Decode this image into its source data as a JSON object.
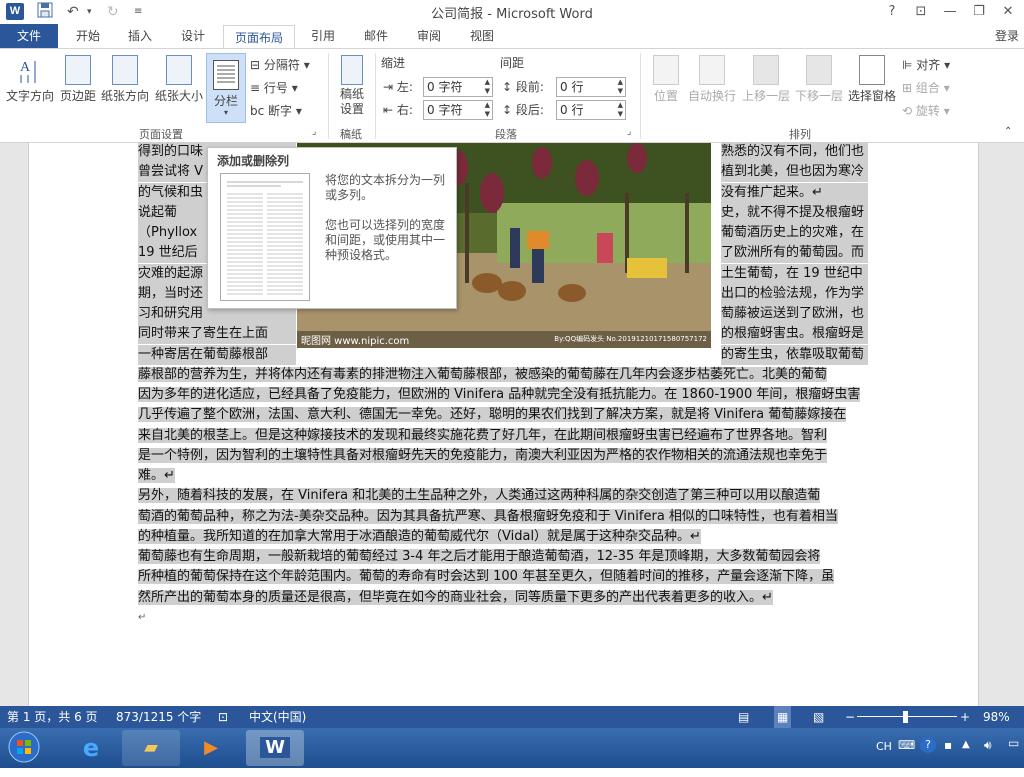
{
  "titlebar": {
    "app_icon": "W",
    "title": "公司简报 - Microsoft Word",
    "help": "?",
    "ribbon_display": "⊡",
    "minimize": "—",
    "restore": "❐",
    "close": "✕"
  },
  "tabs": {
    "file": "文件",
    "home": "开始",
    "insert": "插入",
    "design": "设计",
    "layout": "页面布局",
    "references": "引用",
    "mailings": "邮件",
    "review": "审阅",
    "view": "视图",
    "signin": "登录"
  },
  "ribbon": {
    "text_direction": "文字方向",
    "margins": "页边距",
    "orientation": "纸张方向",
    "size": "纸张大小",
    "columns": "分栏",
    "breaks": "分隔符",
    "line_numbers": "行号",
    "hyphenation": "断字",
    "group_page_setup": "页面设置",
    "draft_grid": "稿纸\n设置",
    "group_draft": "稿纸",
    "indent_title": "缩进",
    "spacing_title": "间距",
    "indent_left_label": "左:",
    "indent_left_value": "0 字符",
    "indent_right_label": "右:",
    "indent_right_value": "0 字符",
    "spacing_before_label": "段前:",
    "spacing_before_value": "0 行",
    "spacing_after_label": "段后:",
    "spacing_after_value": "0 行",
    "group_paragraph": "段落",
    "position": "位置",
    "wrap_text": "自动换行",
    "bring_forward": "上移一层",
    "send_backward": "下移一层",
    "selection_pane": "选择窗格",
    "align": "对齐",
    "group_obj": "组合",
    "rotate": "旋转",
    "group_arrange": "排列"
  },
  "tooltip": {
    "title": "添加或删除列",
    "line1": "将您的文本拆分为一列",
    "line2": "或多列。",
    "line3": "您也可以选择列的宽度",
    "line4": "和间距，或使用其中一",
    "line5": "种预设格式。"
  },
  "doc": {
    "lines": [
      {
        "l": "得到的口味",
        "r": "熟悉的汉有不同，他们也"
      },
      {
        "l": "曾尝试将 V",
        "r": "植到北美，但也因为寒冷"
      },
      {
        "l": "的气候和虫",
        "r": "没有推广起来。↵"
      },
      {
        "l": "    说起葡",
        "r": "史，就不得不提及根瘤蚜"
      },
      {
        "l": "（Phyllox",
        "r": "葡萄酒历史上的灾难，在"
      },
      {
        "l": "19 世纪后",
        "r": "了欧洲所有的葡萄园。而"
      },
      {
        "l": "灾难的起源",
        "r": "土生葡萄，在 19 世纪中"
      },
      {
        "l": "期，当时还",
        "r": "出口的检验法规，作为学"
      },
      {
        "l": "习和研究用",
        "r": "萄藤被运送到了欧洲，也"
      },
      {
        "l": "同时带来了寄生在上面",
        "r": "的根瘤蚜害虫。根瘤蚜是"
      },
      {
        "l": "一种寄居在葡萄藤根部",
        "r": "的寄生虫，依靠吸取葡萄"
      }
    ],
    "full_lines": [
      "藤根部的营养为生，并将体内还有毒素的排泄物注入葡萄藤根部，被感染的葡萄藤在几年内会逐步枯萎死亡。北美的葡萄",
      "因为多年的进化适应，已经具备了免疫能力，但欧洲的 Vinifera 品种就完全没有抵抗能力。在 1860-1900 年间，根瘤蚜虫害",
      "几乎传遍了整个欧洲，法国、意大利、德国无一幸免。还好，聪明的果农们找到了解决方案，就是将 Vinifera 葡萄藤嫁接在",
      "来自北美的根茎上。但是这种嫁接技术的发现和最终实施花费了好几年，在此期间根瘤蚜虫害已经遍布了世界各地。智利",
      "是一个特例，因为智利的土壤特性具备对根瘤蚜先天的免疫能力，南澳大利亚因为严格的农作物相关的流通法规也幸免于",
      "难。↵",
      "    另外，随着科技的发展，在 Vinifera 和北美的土生品种之外，人类通过这两种科属的杂交创造了第三种可以用以酿造葡",
      "萄酒的葡萄品种，称之为法-美杂交品种。因为其具备抗严寒、具备根瘤蚜免疫和于 Vinifera 相似的口味特性，也有着相当",
      "的种植量。我所知道的在加拿大常用于冰酒酿造的葡萄威代尔（Vidal）就是属于这种杂交品种。↵",
      "    葡萄藤也有生命周期，一般新栽培的葡萄经过 3-4 年之后才能用于酿造葡萄酒，12-35 年是顶峰期，大多数葡萄园会将",
      "所种植的葡萄保持在这个年龄范围内。葡萄的寿命有时会达到 100 年甚至更久，但随着时间的推移，产量会逐渐下降，虽",
      "然所产出的葡萄本身的质量还是很高，但毕竟在如今的商业社会，同等质量下更多的产出代表着更多的收入。↵"
    ],
    "last_mark": "↵",
    "photo_watermark_left": "昵图网 www.nipic.com",
    "photo_watermark_right": "By:QQ编码发头 No.20191210171580757172"
  },
  "status": {
    "page": "第 1 页，共 6 页",
    "words": "873/1215 个字",
    "lang": "中文(中国)",
    "zoom": "98%",
    "zoom_minus": "−",
    "zoom_plus": "+"
  },
  "taskbar": {
    "ime": "CH",
    "help": "?"
  }
}
